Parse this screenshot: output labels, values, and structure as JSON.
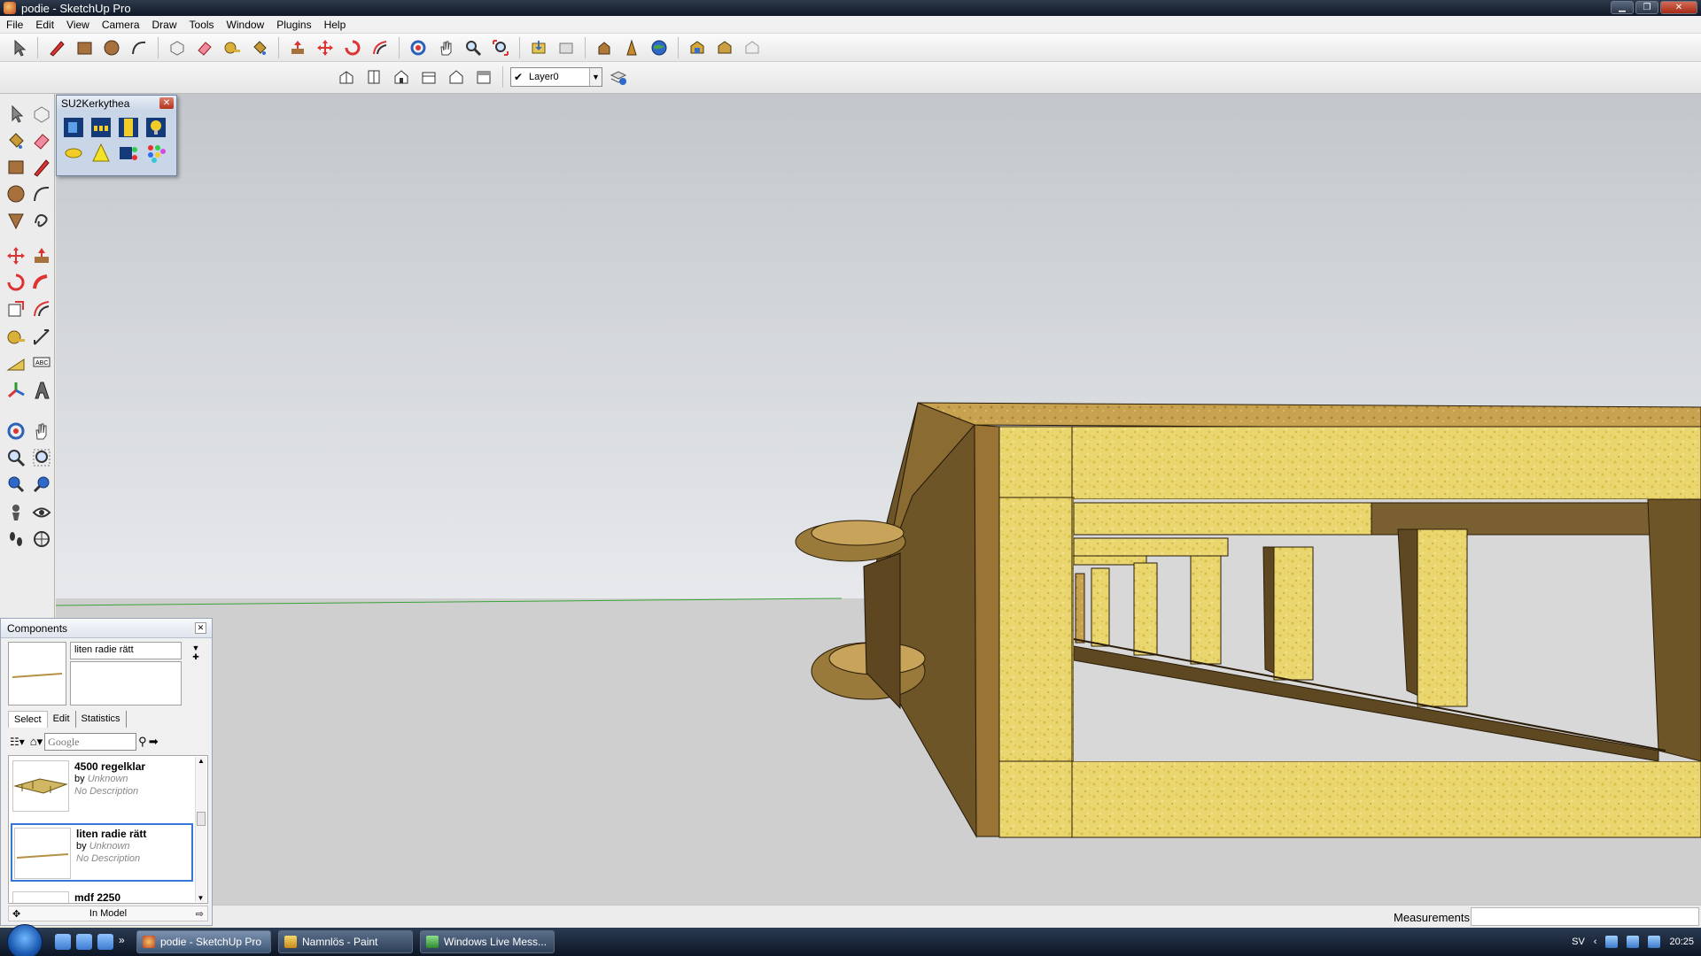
{
  "window": {
    "title": "podie - SketchUp Pro"
  },
  "menu": [
    "File",
    "Edit",
    "View",
    "Camera",
    "Draw",
    "Tools",
    "Window",
    "Plugins",
    "Help"
  ],
  "toolbar": {
    "layer_name": "Layer0"
  },
  "kerkythea": {
    "title": "SU2Kerkythea"
  },
  "components": {
    "title": "Components",
    "selected_name": "liten radie rätt",
    "tabs": [
      "Select",
      "Edit",
      "Statistics"
    ],
    "search_placeholder": "Google",
    "items": [
      {
        "name": "4500 regelklar",
        "by_prefix": "by",
        "author": "Unknown",
        "description": "No Description"
      },
      {
        "name": "liten radie rätt",
        "by_prefix": "by",
        "author": "Unknown",
        "description": "No Description"
      },
      {
        "name": "mdf 2250"
      }
    ],
    "footer": "In Model"
  },
  "status": {
    "measurements_label": "Measurements"
  },
  "taskbar": {
    "tasks": [
      {
        "label": "podie - SketchUp Pro",
        "active": true
      },
      {
        "label": "Namnlös - Paint",
        "active": false
      },
      {
        "label": "Windows Live Mess...",
        "active": false
      }
    ],
    "lang": "SV",
    "clock": "20:25"
  },
  "colors": {
    "sky": "#c9cdd1",
    "ground": "#cfcfcf",
    "wood_light": "#e9d56b",
    "wood_dark": "#6a5326",
    "selection": "#3875d7"
  }
}
